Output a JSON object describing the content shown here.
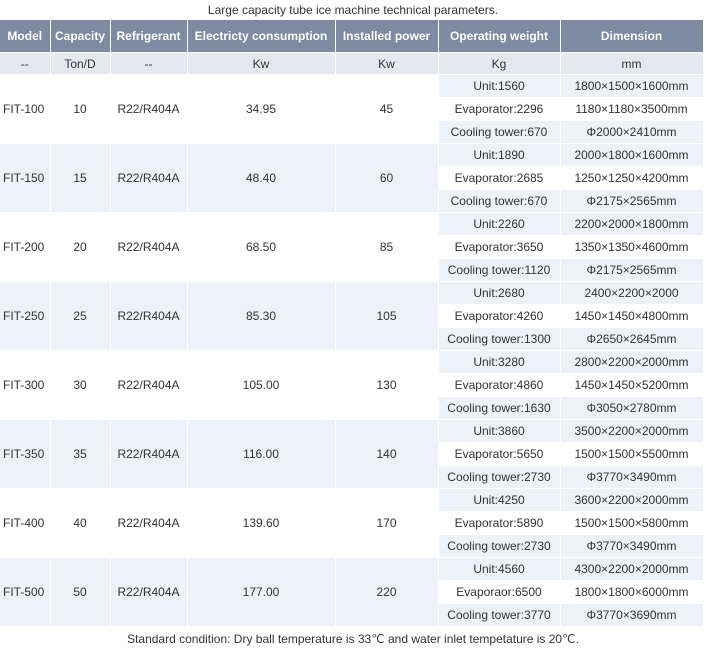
{
  "caption": "Large capacity tube ice machine technical parameters.",
  "headers": [
    "Model",
    "Capacity",
    "Refrigerant",
    "Electricty consumption",
    "Installed power",
    "Operating weight",
    "Dimension"
  ],
  "units": [
    "--",
    "Ton/D",
    "--",
    "Kw",
    "Kw",
    "Kg",
    "mm"
  ],
  "rows": [
    {
      "model": "FIT-100",
      "capacity": "10",
      "refrigerant": "R22/R404A",
      "consumption": "34.95",
      "power": "45",
      "weights": [
        "Unit:1560",
        "Evaporator:2296",
        "Cooling tower:670"
      ],
      "dims": [
        "1800×1500×1600mm",
        "1180×1180×3500mm",
        "Φ2000×2410mm"
      ]
    },
    {
      "model": "FIT-150",
      "capacity": "15",
      "refrigerant": "R22/R404A",
      "consumption": "48.40",
      "power": "60",
      "weights": [
        "Unit:1890",
        "Evaporator:2685",
        "Cooling tower:670"
      ],
      "dims": [
        "2000×1800×1600mm",
        "1250×1250×4200mm",
        "Φ2175×2565mm"
      ]
    },
    {
      "model": "FIT-200",
      "capacity": "20",
      "refrigerant": "R22/R404A",
      "consumption": "68.50",
      "power": "85",
      "weights": [
        "Unit:2260",
        "Evaporator:3650",
        "Cooling tower:1120"
      ],
      "dims": [
        "2200×2000×1800mm",
        "1350×1350×4600mm",
        "Φ2175×2565mm"
      ]
    },
    {
      "model": "FIT-250",
      "capacity": "25",
      "refrigerant": "R22/R404A",
      "consumption": "85.30",
      "power": "105",
      "weights": [
        "Unit:2680",
        "Evaporator:4260",
        "Cooling tower:1300"
      ],
      "dims": [
        "2400×2200×2000",
        "1450×1450×4800mm",
        "Φ2650×2645mm"
      ]
    },
    {
      "model": "FIT-300",
      "capacity": "30",
      "refrigerant": "R22/R404A",
      "consumption": "105.00",
      "power": "130",
      "weights": [
        "Unit:3280",
        "Evaporator:4860",
        "Cooling tower:1630"
      ],
      "dims": [
        "2800×2200×2000mm",
        "1450×1450×5200mm",
        "Φ3050×2780mm"
      ]
    },
    {
      "model": "FIT-350",
      "capacity": "35",
      "refrigerant": "R22/R404A",
      "consumption": "116.00",
      "power": "140",
      "weights": [
        "Unit:3860",
        "Evaporator:5650",
        "Cooling tower:2730"
      ],
      "dims": [
        "3500×2200×2000mm",
        "1500×1500×5500mm",
        "Φ3770×3490mm"
      ]
    },
    {
      "model": "FIT-400",
      "capacity": "40",
      "refrigerant": "R22/R404A",
      "consumption": "139.60",
      "power": "170",
      "weights": [
        "Unit:4250",
        "Evaporator:5890",
        "Cooling tower:2730"
      ],
      "dims": [
        "3600×2200×2000mm",
        "1500×1500×5800mm",
        "Φ3770×3490mm"
      ]
    },
    {
      "model": "FIT-500",
      "capacity": "50",
      "refrigerant": "R22/R404A",
      "consumption": "177.00",
      "power": "220",
      "weights": [
        "Unit:4560",
        "Evaporaor:6500",
        "Cooling tower:3770"
      ],
      "dims": [
        "4300×2200×2000mm",
        "1800×1800×6000mm",
        "Φ3770×3690mm"
      ]
    }
  ],
  "footer": "Standard condition: Dry ball temperature is 33℃ and water inlet tempetature is 20℃."
}
